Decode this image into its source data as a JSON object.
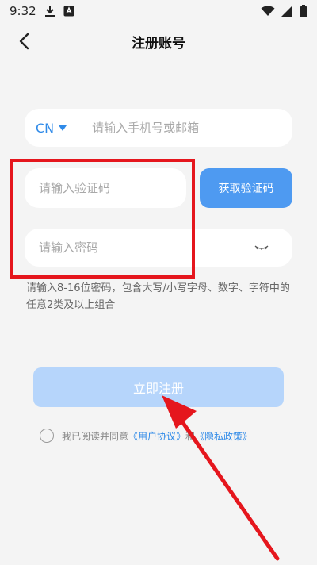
{
  "status_bar": {
    "time": "9:32",
    "icons": [
      "download-icon",
      "app-notification-icon",
      "wifi-icon",
      "signal-icon",
      "battery-icon"
    ]
  },
  "nav": {
    "title": "注册账号",
    "back_icon": "chevron-left-icon"
  },
  "form": {
    "country_code": "CN",
    "phone_placeholder": "请输入手机号或邮箱",
    "code_placeholder": "请输入验证码",
    "get_code_label": "获取验证码",
    "password_placeholder": "请输入密码",
    "password_visibility_icon": "eye-closed-icon",
    "password_hint": "请输入8-16位密码，包含大写/小写字母、数字、字符中的任意2类及以上组合"
  },
  "register_label": "立即注册",
  "agreement": {
    "prefix": "我已阅读并同意",
    "user_agreement": "《用户协议》",
    "connector": "和",
    "privacy_policy": "《隐私政策》"
  },
  "colors": {
    "accent": "#2f8ae8",
    "button_blue": "#4e9af1",
    "register_disabled": "#b6d5fb",
    "annotation_red": "#e5161d",
    "background": "#f4f4f4"
  }
}
